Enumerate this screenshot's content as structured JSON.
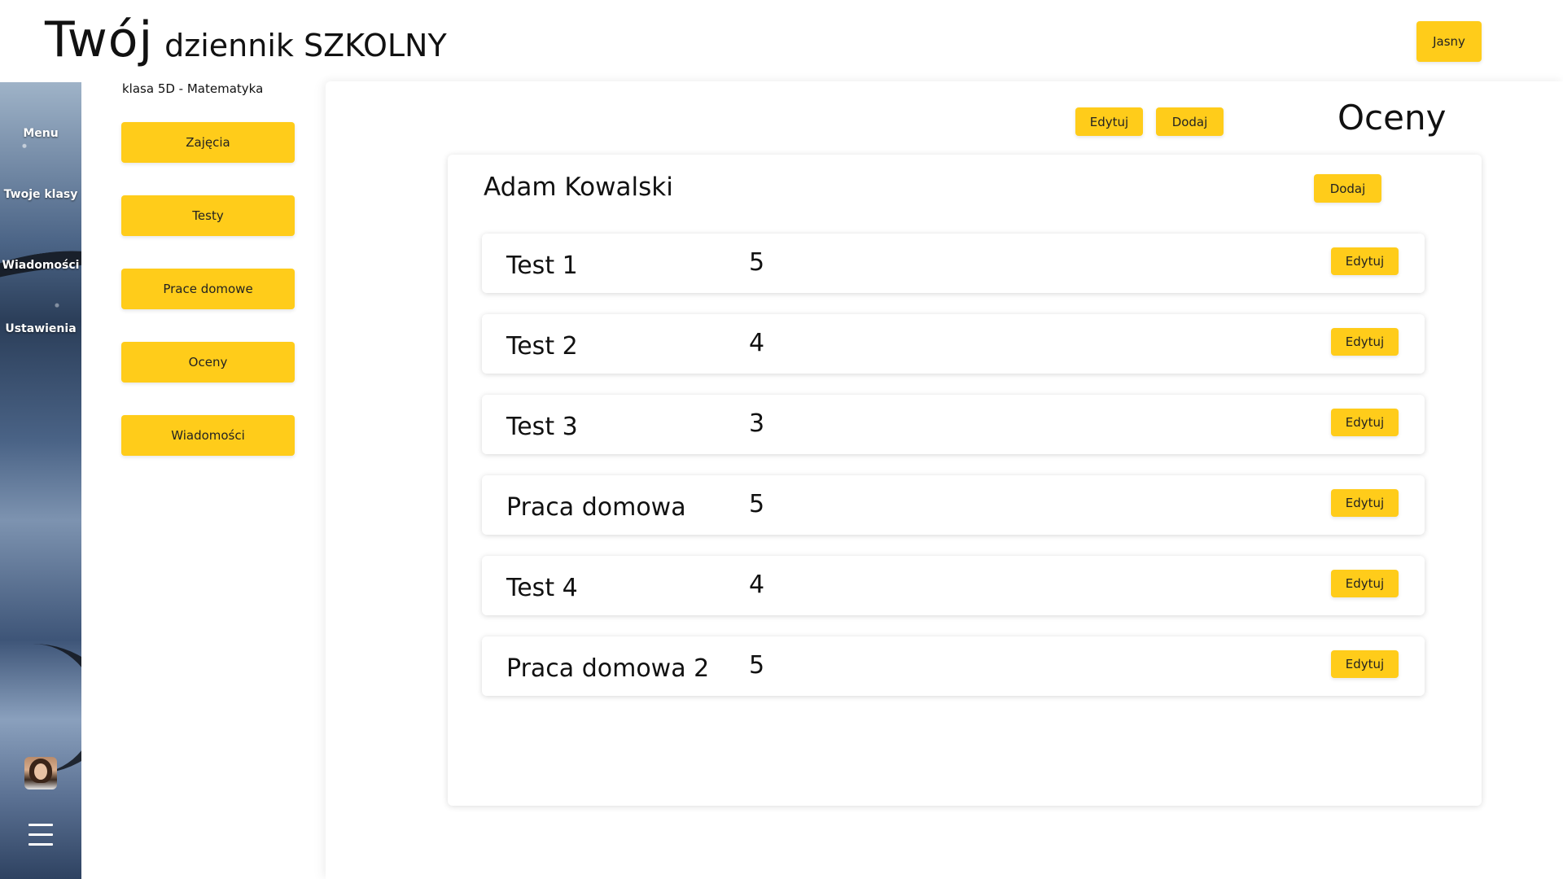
{
  "header": {
    "title_big": "Twój",
    "title_small": "dziennik SZKOLNY",
    "theme_button": "Jasny"
  },
  "rail": {
    "items": [
      "Menu",
      "Twoje klasy",
      "Wiadomości",
      "Ustawienia"
    ]
  },
  "subnav": {
    "class_label": "klasa 5D - Matematyka",
    "items": [
      "Zajęcia",
      "Testy",
      "Prace domowe",
      "Oceny",
      "Wiadomości"
    ]
  },
  "main": {
    "heading": "Oceny",
    "edit_button": "Edytuj",
    "add_button": "Dodaj",
    "student": {
      "name": "Adam Kowalski",
      "add_button": "Dodaj",
      "grades": [
        {
          "name": "Test 1",
          "value": "5",
          "edit": "Edytuj"
        },
        {
          "name": "Test 2",
          "value": "4",
          "edit": "Edytuj"
        },
        {
          "name": "Test 3",
          "value": "3",
          "edit": "Edytuj"
        },
        {
          "name": "Praca domowa",
          "value": "5",
          "edit": "Edytuj"
        },
        {
          "name": "Test 4",
          "value": "4",
          "edit": "Edytuj"
        },
        {
          "name": "Praca domowa 2",
          "value": "5",
          "edit": "Edytuj"
        }
      ]
    }
  },
  "colors": {
    "accent": "#ffcc1a"
  }
}
